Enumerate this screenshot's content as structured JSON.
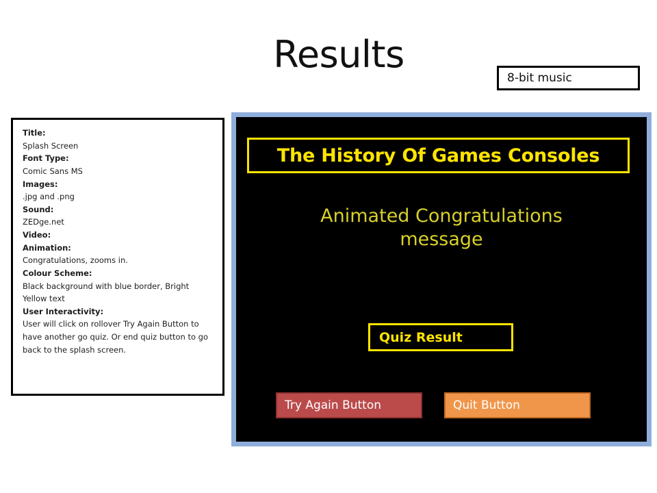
{
  "slide": {
    "title": "Results"
  },
  "music_callout": {
    "label": "8-bit music"
  },
  "spec_box": {
    "entries": [
      {
        "label": "Title:",
        "value": "Splash Screen"
      },
      {
        "label": "Font Type:",
        "value": "Comic Sans MS"
      },
      {
        "label": "Images:",
        "value": ".jpg and .png"
      },
      {
        "label": "Sound:",
        "value": "ZEDge.net"
      },
      {
        "label": "Video:",
        "value": ""
      },
      {
        "label": "Animation:",
        "value": "Congratulations, zooms in."
      },
      {
        "label": "Colour Scheme:",
        "value": "Black background with blue border, Bright Yellow text"
      },
      {
        "label": "User Interactivity:",
        "value": "User will click on rollover Try Again Button to have another go quiz.\nOr end quiz button to go back to the splash screen."
      }
    ]
  },
  "mockup": {
    "title": "The History Of Games Consoles",
    "congrats_message": "Animated Congratulations message",
    "quiz_result_label": "Quiz Result",
    "buttons": [
      {
        "label": "Try Again Button"
      },
      {
        "label": "Quit Button"
      }
    ]
  },
  "colors": {
    "screen_background": "#000000",
    "screen_border_blue": "#8faedb",
    "bright_yellow": "#ffe400",
    "message_yellow": "#d8d02a",
    "try_again_red": "#bb4b4b",
    "quit_orange": "#f0964b",
    "outline_black": "#000000",
    "page_background": "#ffffff"
  }
}
